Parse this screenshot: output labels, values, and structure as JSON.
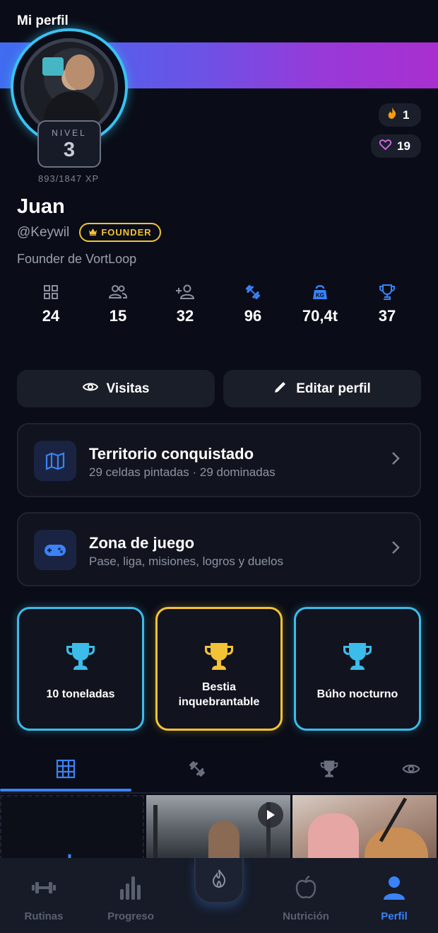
{
  "header": {
    "title": "Mi perfil"
  },
  "profile": {
    "level_label": "NIVEL",
    "level": "3",
    "xp": "893/1847 XP",
    "streak": "1",
    "likes": "19",
    "name": "Juan",
    "handle": "@Keywil",
    "badge": "FOUNDER",
    "bio": "Founder de VortLoop"
  },
  "stats": [
    {
      "icon": "grid-icon",
      "value": "24"
    },
    {
      "icon": "followers-icon",
      "value": "15"
    },
    {
      "icon": "add-person-icon",
      "value": "32"
    },
    {
      "icon": "dumbbell-icon",
      "value": "96"
    },
    {
      "icon": "kettlebell-icon",
      "value": "70,4t"
    },
    {
      "icon": "trophy-icon",
      "value": "37"
    }
  ],
  "actions": {
    "visits": "Visitas",
    "edit": "Editar perfil"
  },
  "cards": [
    {
      "title": "Territorio conquistado",
      "subtitle": "29 celdas pintadas · 29 dominadas",
      "icon": "map-icon"
    },
    {
      "title": "Zona de juego",
      "subtitle": "Pase, liga, misiones, logros y duelos",
      "icon": "gamepad-icon"
    }
  ],
  "achievements": [
    {
      "label": "10 toneladas",
      "color": "#3bbcea"
    },
    {
      "label": "Bestia inquebrantable",
      "color": "#f4c236"
    },
    {
      "label": "Búho nocturno",
      "color": "#3bbcea"
    }
  ],
  "colors": {
    "accent": "#3b82f6",
    "background": "#0a0d17",
    "gold": "#f2c335",
    "cyan": "#39c2f2"
  },
  "tabs": [
    "grid-icon",
    "dumbbell-icon",
    "trophy-icon",
    "eye-icon"
  ],
  "nav": [
    {
      "label": "Rutinas",
      "icon": "dumbbell-icon"
    },
    {
      "label": "Progreso",
      "icon": "bars-icon"
    },
    {
      "label": "",
      "icon": "flame-icon"
    },
    {
      "label": "Nutrición",
      "icon": "apple-icon"
    },
    {
      "label": "Perfil",
      "icon": "person-icon"
    }
  ]
}
